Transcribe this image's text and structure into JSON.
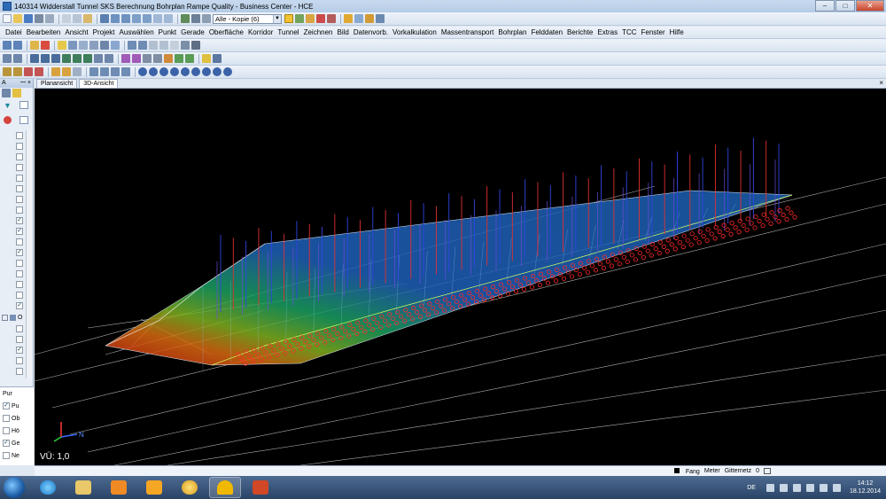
{
  "window": {
    "title": "140314 Widderstall Tunnel SKS Berechnung Bohrplan Rampe Quality - Business Center - HCE",
    "controls": {
      "minimize": "–",
      "maximize": "□",
      "close": "✕"
    }
  },
  "toolbar1": {
    "layer_combo": "Alle - Kopie (6)",
    "combo_arrow": "▼"
  },
  "menu": [
    "Datei",
    "Bearbeiten",
    "Ansicht",
    "Projekt",
    "Auswählen",
    "Punkt",
    "Gerade",
    "Oberfläche",
    "Korridor",
    "Tunnel",
    "Zeichnen",
    "Bild",
    "Datenvorb.",
    "Vorkalkulation",
    "Massentransport",
    "Bohrplan",
    "Felddaten",
    "Berichte",
    "Extras",
    "TCC",
    "Fenster",
    "Hilfe"
  ],
  "left_panel": {
    "header": "A",
    "pin": "ꟷ",
    "close": "×",
    "group_label": "O",
    "check_mark": "✓",
    "bottom_items": [
      {
        "label": "Pur",
        "checked": false
      },
      {
        "label": "Pu",
        "checked": true
      },
      {
        "label": "Ob",
        "checked": false
      },
      {
        "label": "Hö",
        "checked": false
      },
      {
        "label": "Ge",
        "checked": true
      },
      {
        "label": "Ne",
        "checked": false
      }
    ]
  },
  "tabs": [
    {
      "label": "Planansicht",
      "active": false
    },
    {
      "label": "3D-Ansicht",
      "active": true
    }
  ],
  "tab_close": "×",
  "viewport": {
    "overlay_text": "VÜ: 1,0",
    "axis_labels": {
      "north": "N"
    }
  },
  "status": {
    "fang": "Fang",
    "units": "Meter",
    "grid": "Gitternetz",
    "value": "0"
  },
  "taskbar": {
    "language": "DE",
    "time": "14:12",
    "date": "18.12.2014"
  }
}
